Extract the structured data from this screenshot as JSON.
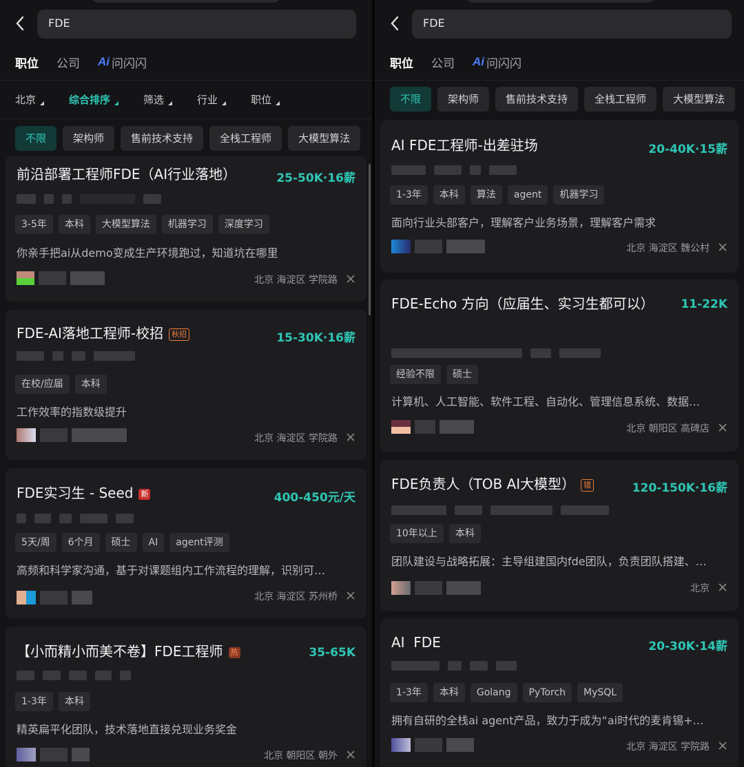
{
  "left": {
    "search": {
      "query": "FDE"
    },
    "tabs": [
      {
        "label": "职位"
      },
      {
        "label": "公司"
      },
      {
        "label": "问闪闪",
        "ai": true
      }
    ],
    "sort": [
      {
        "label": "北京"
      },
      {
        "label": "综合排序"
      },
      {
        "label": "筛选"
      },
      {
        "label": "行业"
      },
      {
        "label": "职位"
      }
    ],
    "chips": [
      "不限",
      "架构师",
      "售前技术支持",
      "全栈工程师",
      "大模型算法"
    ],
    "cards": [
      {
        "title": "前沿部署工程师FDE（AI行业落地）",
        "salary": "25-50K·16薪",
        "tags": [
          "3-5年",
          "本科",
          "大模型算法",
          "机器学习",
          "深度学习"
        ],
        "desc": "你亲手把ai从demo变成生产环境跑过，知道坑在哪里",
        "location": "北京 海淀区 学院路"
      },
      {
        "title": "FDE-AI落地工程师-校招",
        "badge": "秋招",
        "salary": "15-30K·16薪",
        "tags": [
          "在校/应届",
          "本科"
        ],
        "desc": "工作效率的指数级提升",
        "location": "北京 海淀区 学院路"
      },
      {
        "title": "FDE实习生 - Seed",
        "badge": "新",
        "salary": "400-450元/天",
        "tags": [
          "5天/周",
          "6个月",
          "硕士",
          "AI",
          "agent评测"
        ],
        "desc": "高频和科学家沟通，基于对课题组内工作流程的理解，识别可…",
        "location": "北京 海淀区 苏州桥"
      },
      {
        "title": "【小而精小而美不卷】FDE工程师",
        "badge": "热",
        "salary": "35-65K",
        "tags": [
          "1-3年",
          "本科"
        ],
        "desc": "精英扁平化团队，技术落地直接兑现业务奖金",
        "location": "北京 朝阳区 朝外"
      }
    ]
  },
  "right": {
    "search": {
      "query": "FDE"
    },
    "tabs": [
      {
        "label": "职位"
      },
      {
        "label": "公司"
      },
      {
        "label": "问闪闪",
        "ai": true
      }
    ],
    "chips": [
      "不限",
      "架构师",
      "售前技术支持",
      "全栈工程师",
      "大模型算法"
    ],
    "cards": [
      {
        "title": "AI FDE工程师-出差驻场",
        "salary": "20-40K·15薪",
        "tags": [
          "1-3年",
          "本科",
          "算法",
          "agent",
          "机器学习"
        ],
        "desc": "面向行业头部客户，理解客户业务场景，理解客户需求",
        "location": "北京 海淀区 魏公村"
      },
      {
        "title": "FDE-Echo 方向（应届生、实习生都可以）",
        "salary": "11-22K",
        "tags": [
          "经验不限",
          "硕士"
        ],
        "desc": "计算机、人工智能、软件工程、自动化、管理信息系统、数据…",
        "location": "北京 朝阳区 高碑店"
      },
      {
        "title": "FDE负责人（TOB AI大模型）",
        "badge": "猎",
        "salary": "120-150K·16薪",
        "tags": [
          "10年以上",
          "本科"
        ],
        "desc": "团队建设与战略拓展：主导组建国内fde团队，负责团队搭建、…",
        "location": "北京"
      },
      {
        "title": "AI  FDE",
        "salary": "20-30K·14薪",
        "tags": [
          "1-3年",
          "本科",
          "Golang",
          "PyTorch",
          "MySQL"
        ],
        "desc": "拥有自研的全栈ai agent产品，致力于成为“ai时代的麦肯锡+…",
        "location": "北京 海淀区 学院路"
      }
    ]
  },
  "colors": {
    "accent": "#2fc6b4",
    "card": "#1d1d20",
    "background": "#141416"
  }
}
